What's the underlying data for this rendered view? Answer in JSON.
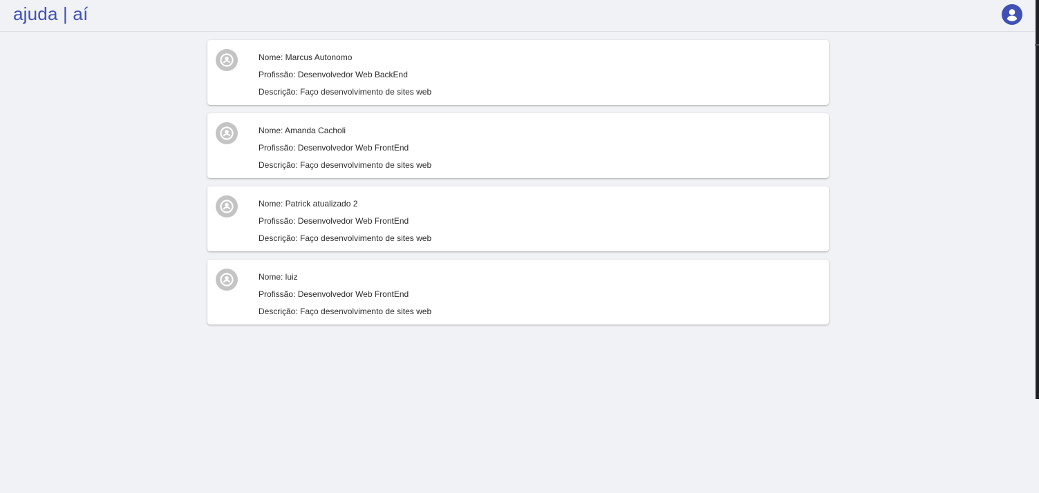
{
  "header": {
    "brand": "ajuda | aí",
    "account_icon": "account-circle-icon",
    "accent_color": "#3f51b5"
  },
  "profiles": [
    {
      "nome": "Nome: Marcus Autonomo",
      "profissao": "Profissão: Desenvolvedor Web BackEnd",
      "descricao": "Descrição: Faço desenvolvimento de sites web"
    },
    {
      "nome": "Nome: Amanda Cacholi",
      "profissao": "Profissão: Desenvolvedor Web FrontEnd",
      "descricao": "Descrição: Faço desenvolvimento de sites web"
    },
    {
      "nome": "Nome: Patrick atualizado 2",
      "profissao": "Profissão: Desenvolvedor Web FrontEnd",
      "descricao": "Descrição: Faço desenvolvimento de sites web"
    },
    {
      "nome": "Nome: luiz",
      "profissao": "Profissão: Desenvolvedor Web FrontEnd",
      "descricao": "Descrição: Faço desenvolvimento de sites web"
    }
  ],
  "avatar_icon": "person-circle-icon"
}
